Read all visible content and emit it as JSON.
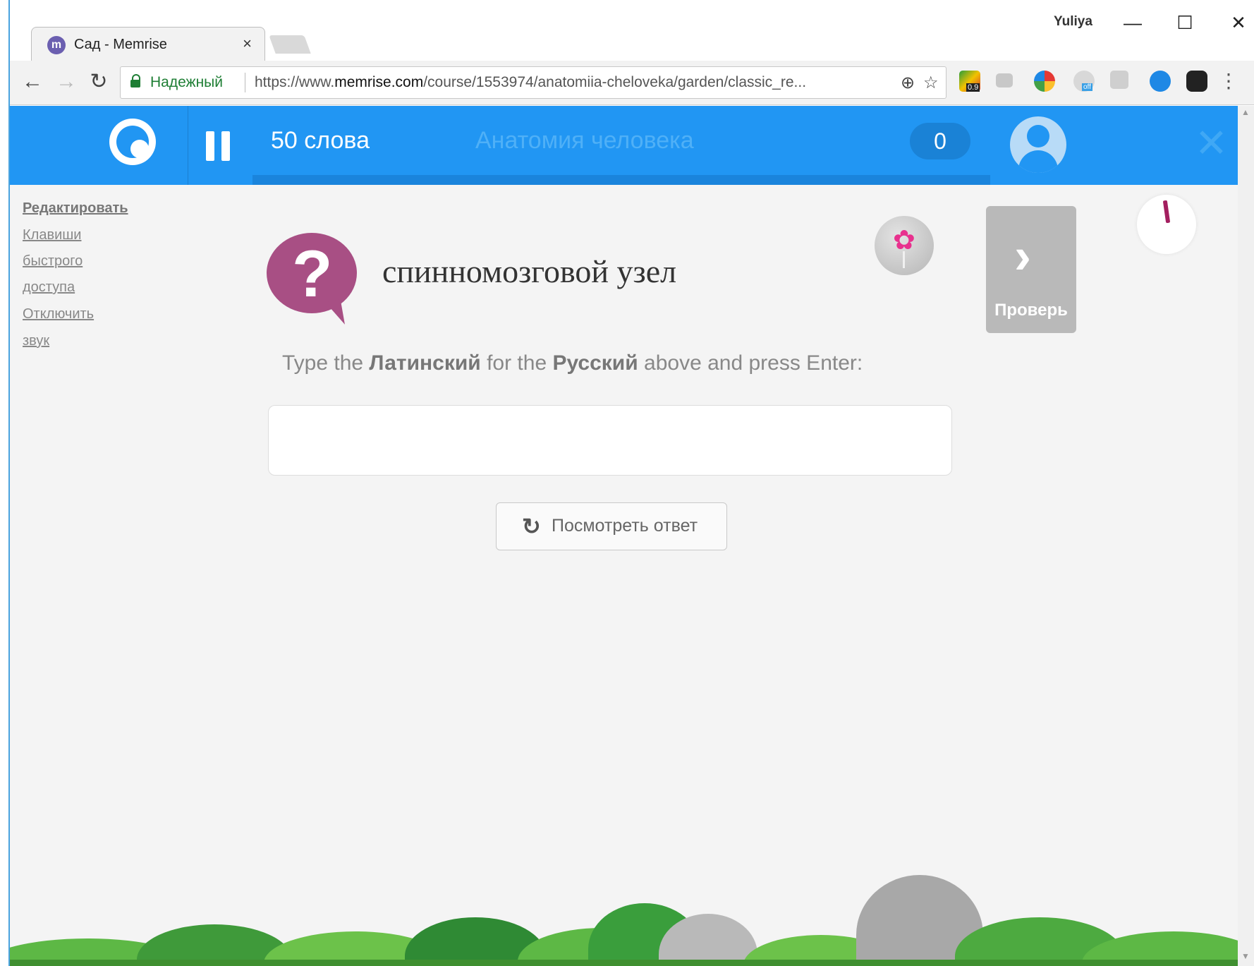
{
  "browser": {
    "tab_title": "Сад - Memrise",
    "tab_favicon_letter": "m",
    "tab_close": "×",
    "user_name": "Yuliya",
    "window_controls": {
      "minimize": "—",
      "maximize": "☐",
      "close": "✕"
    },
    "nav": {
      "back": "←",
      "forward": "→",
      "reload": "↻"
    },
    "secure_label": "Надежный",
    "url_prefix": "https://www.",
    "url_domain": "memrise.com",
    "url_path": "/course/1553974/anatomiia-cheloveka/garden/classic_re...",
    "zoom_icon": "⊕",
    "bookmark_icon": "☆",
    "extension_badge": "0.9",
    "ext_off_badge": "off",
    "menu_icon": "⋮"
  },
  "app_header": {
    "word_count": "50 слова",
    "course_title": "Анатомия человека",
    "points": "0",
    "close_icon": "✕"
  },
  "sidebar": {
    "links": [
      "Редактировать",
      "Клавиши",
      "быстрого",
      "доступа",
      "Отключить",
      "звук"
    ]
  },
  "question": {
    "icon": "?",
    "prompt": "спинномозговой узел",
    "instructions_pre": "Type the ",
    "target_language": "Латинский",
    "instructions_mid": " for the ",
    "source_language": "Русский",
    "instructions_post": " above and press Enter:",
    "answer_value": "",
    "answer_placeholder": ""
  },
  "actions": {
    "check_label": "Проверь",
    "check_arrow": "›",
    "reveal_icon": "↻",
    "reveal_label": "Посмотреть ответ"
  },
  "colors": {
    "brand_blue": "#2196f3",
    "question_purple": "#a84f84",
    "flower_pink": "#e8318e",
    "secure_green": "#1e7e34"
  }
}
